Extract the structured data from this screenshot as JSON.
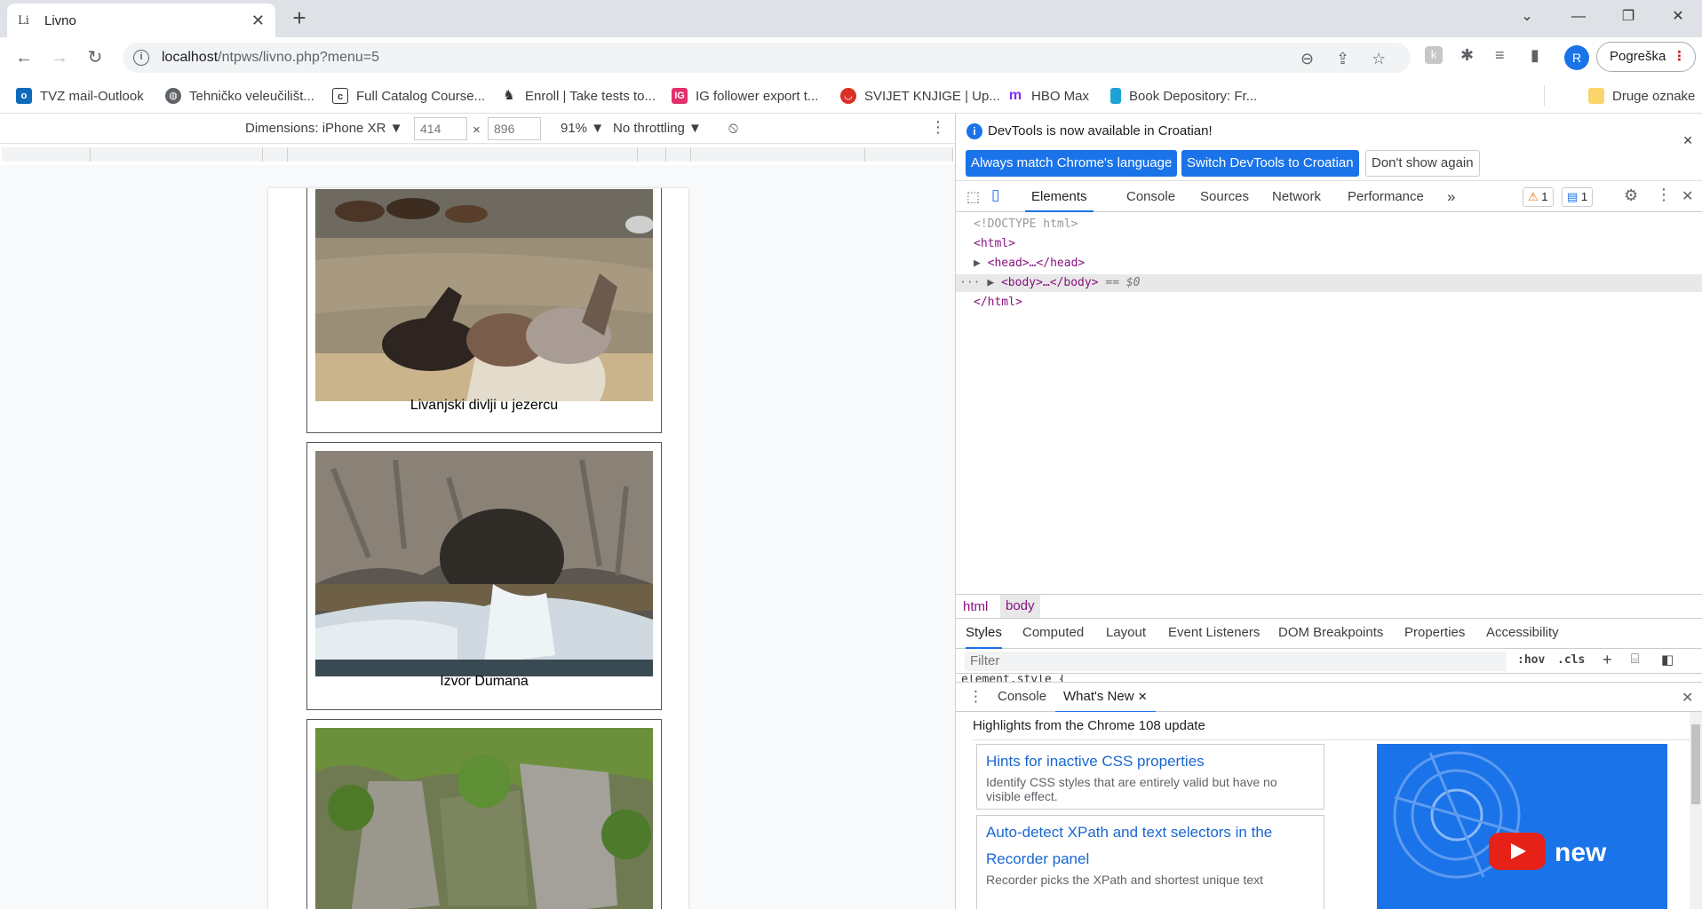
{
  "browser": {
    "tab": {
      "favicon": "Li",
      "title": "Livno"
    },
    "url": {
      "host": "localhost",
      "path": "/ntpws/livno.php?menu=5"
    },
    "profile_initial": "R",
    "error_button": "Pogreška",
    "bookmarks": [
      {
        "label": "TVZ mail-Outlook",
        "icon": "outlook-icon",
        "color": "#0f6cbd"
      },
      {
        "label": "Tehničko veleučilišt...",
        "icon": "globe-icon",
        "color": "#5f6368"
      },
      {
        "label": "Full Catalog Course...",
        "icon": "catalog-icon",
        "color": "#333333"
      },
      {
        "label": "Enroll | Take tests to...",
        "icon": "horse-icon",
        "color": "#333333"
      },
      {
        "label": "IG follower export t...",
        "icon": "ig-icon",
        "color": "#e1306c"
      },
      {
        "label": "SVIJET KNJIGE | Up...",
        "icon": "lips-icon",
        "color": "#d93025"
      },
      {
        "label": "HBO Max",
        "icon": "hbomax-icon",
        "color": "#7b2ff7"
      },
      {
        "label": "Book Depository: Fr...",
        "icon": "book-icon",
        "color": "#1fa3d6"
      }
    ],
    "other_bookmarks": "Druge oznake"
  },
  "device_toolbar": {
    "dimensions_label": "Dimensions: iPhone XR ▼",
    "width": "414",
    "height": "896",
    "times": "×",
    "zoom": "91% ▼",
    "throttling": "No throttling ▼"
  },
  "page": {
    "cards": [
      {
        "caption": "Livanjski divlji u jezercu",
        "photo": "wild-horses-in-lake"
      },
      {
        "caption": "Izvor Dumana",
        "photo": "duman-spring"
      },
      {
        "caption": "",
        "photo": "green-cliff-water"
      }
    ]
  },
  "devtools": {
    "info_message": "DevTools is now available in Croatian!",
    "btn_match": "Always match Chrome's language",
    "btn_switch": "Switch DevTools to Croatian",
    "btn_dont_show": "Don't show again",
    "panels": [
      "Elements",
      "Console",
      "Sources",
      "Network",
      "Performance"
    ],
    "more_panels": "»",
    "warn_count": "1",
    "msg_count": "1",
    "dom": {
      "doctype": "<!DOCTYPE html>",
      "html_open": "<html>",
      "head": "<head>…</head>",
      "body": "<body>…</body>",
      "body_selected_suffix": "== $0",
      "html_close": "</html>"
    },
    "breadcrumbs": [
      "html",
      "body"
    ],
    "styles_tabs": [
      "Styles",
      "Computed",
      "Layout",
      "Event Listeners",
      "DOM Breakpoints",
      "Properties",
      "Accessibility"
    ],
    "filter_placeholder": "Filter",
    "hov": ":hov",
    "cls": ".cls",
    "element_style": "element.style {",
    "drawer_tabs": [
      "Console",
      "What's New"
    ],
    "whats_new_heading": "Highlights from the Chrome 108 update",
    "whats_new_items": [
      {
        "title": "Hints for inactive CSS properties",
        "desc": "Identify CSS styles that are entirely valid but have no visible effect."
      },
      {
        "title": "Auto-detect XPath and text selectors in the Recorder panel",
        "desc": "Recorder picks the XPath and shortest unique text"
      }
    ],
    "promo_text": "new"
  },
  "colors": {
    "accent": "#1a73e8",
    "tag": "#881280"
  }
}
